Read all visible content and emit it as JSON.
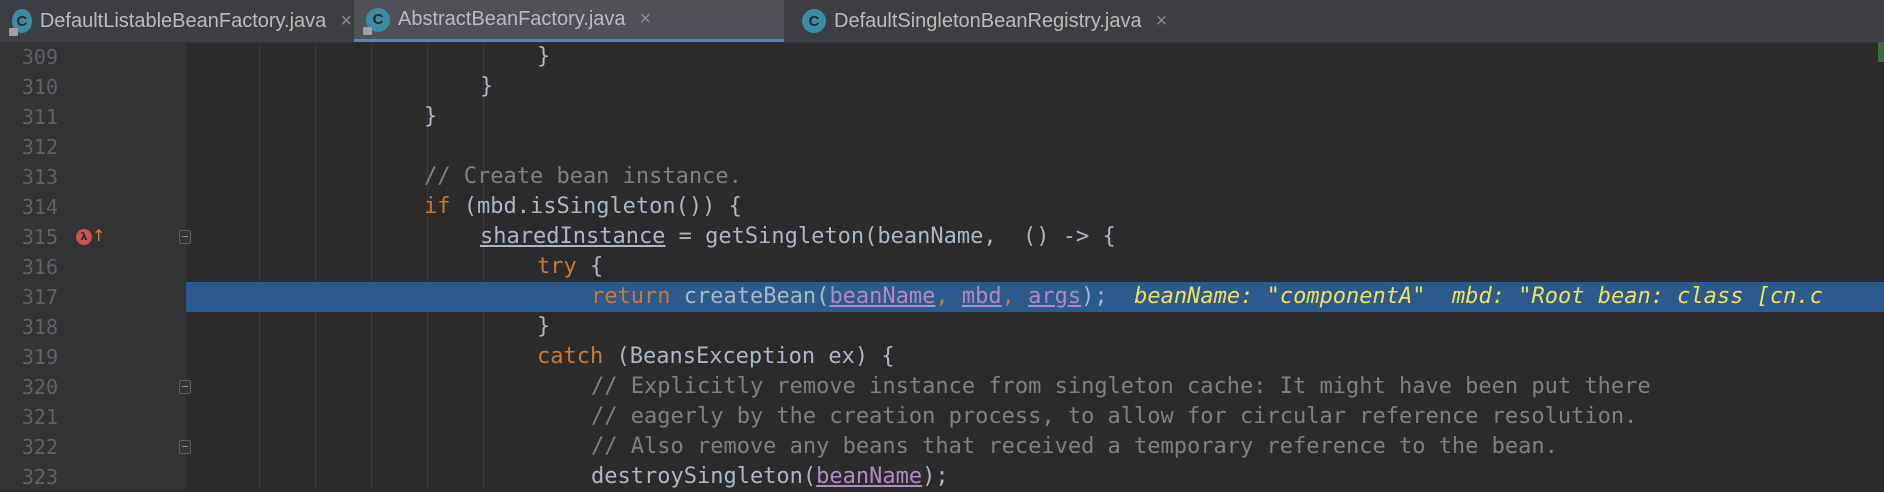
{
  "tabs": [
    {
      "label": "DefaultListableBeanFactory.java",
      "icon_letter": "C",
      "close": "×"
    },
    {
      "label": "AbstractBeanFactory.java",
      "icon_letter": "C",
      "close": "×"
    },
    {
      "label": "DefaultSingletonBeanRegistry.java",
      "icon_letter": "C",
      "close": "×"
    }
  ],
  "active_tab": "AbstractBeanFactory.java",
  "editor": {
    "lines": [
      {
        "num": "309"
      },
      {
        "num": "310"
      },
      {
        "num": "311"
      },
      {
        "num": "312"
      },
      {
        "num": "313"
      },
      {
        "num": "314"
      },
      {
        "num": "315"
      },
      {
        "num": "316"
      },
      {
        "num": "317"
      },
      {
        "num": "318"
      },
      {
        "num": "319"
      },
      {
        "num": "320"
      },
      {
        "num": "321"
      },
      {
        "num": "322"
      },
      {
        "num": "323"
      }
    ],
    "code": {
      "l309": "}",
      "l310": "}",
      "l311": "}",
      "l313": "// Create bean instance.",
      "l314_kw": "if",
      "l314_rest": " (mbd.isSingleton()) {",
      "l315_var": "sharedInstance",
      "l315_rest": " = getSingleton(beanName, ",
      "l315_comma": ",",
      "l315_lambda": " () -> {",
      "l316_kw": "try",
      "l316_rest": " {",
      "l317_kw": "return",
      "l317_call": " createBean(",
      "l317_p1": "beanName",
      "l317_c1": ", ",
      "l317_p2": "mbd",
      "l317_c2": ", ",
      "l317_p3": "args",
      "l317_end": ");",
      "l317_hint": "  beanName: \"componentA\"  mbd: \"Root bean: class [cn.c",
      "l318": "}",
      "l319_kw": "catch",
      "l319_rest": " (BeansException ex) {",
      "l320": "// Explicitly remove instance from singleton cache: It might have been put there",
      "l321": "// eagerly by the creation process, to allow for circular reference resolution.",
      "l322": "// Also remove any beans that received a temporary reference to the bean.",
      "l323_call": "destroySingleton(",
      "l323_p": "beanName",
      "l323_end": ");"
    },
    "breakpoint_line": "315",
    "highlight_line": "317"
  },
  "colors": {
    "background": "#2b2b2b",
    "gutter": "#313335",
    "keyword": "#cc7832",
    "comment": "#808080",
    "param": "#b389c5",
    "inline_hint": "#f0e05a",
    "highlight": "#2d5a8c"
  }
}
